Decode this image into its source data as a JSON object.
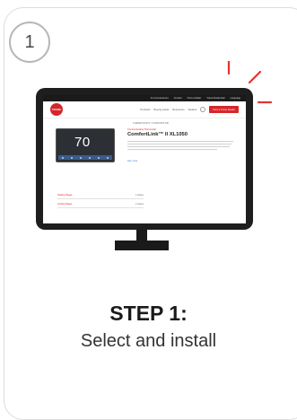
{
  "step": {
    "number": "1",
    "title": "STEP 1:",
    "subtitle": "Select and install"
  },
  "colors": {
    "accent": "#d6262b",
    "sparkle": "#e8322f",
    "monitor": "#1e1e1e"
  },
  "website": {
    "topbar_links": [
      "For Homeowners",
      "Contact",
      "Find a Dealer",
      "Trane Residential",
      "Language"
    ],
    "logo_text": "TRANE",
    "nav_links": [
      "Products",
      "Buying Guide",
      "Resources",
      "Dealers"
    ],
    "nav_button": "Find a Trane Dealer",
    "breadcrumb": "THERMOSTATS / COMFORTLINK",
    "product_category": "Communicating Thermostat",
    "product_name": "ComfortLink™ II XL1050",
    "see_more": "See more",
    "thermostat_display": "70",
    "specs": [
      {
        "label": "Heating Stages",
        "value": "4 stages"
      },
      {
        "label": "Cooling Stages",
        "value": "2 stages"
      }
    ]
  },
  "icons": {
    "sparkle": "sparkle-icon",
    "search": "search-icon"
  }
}
